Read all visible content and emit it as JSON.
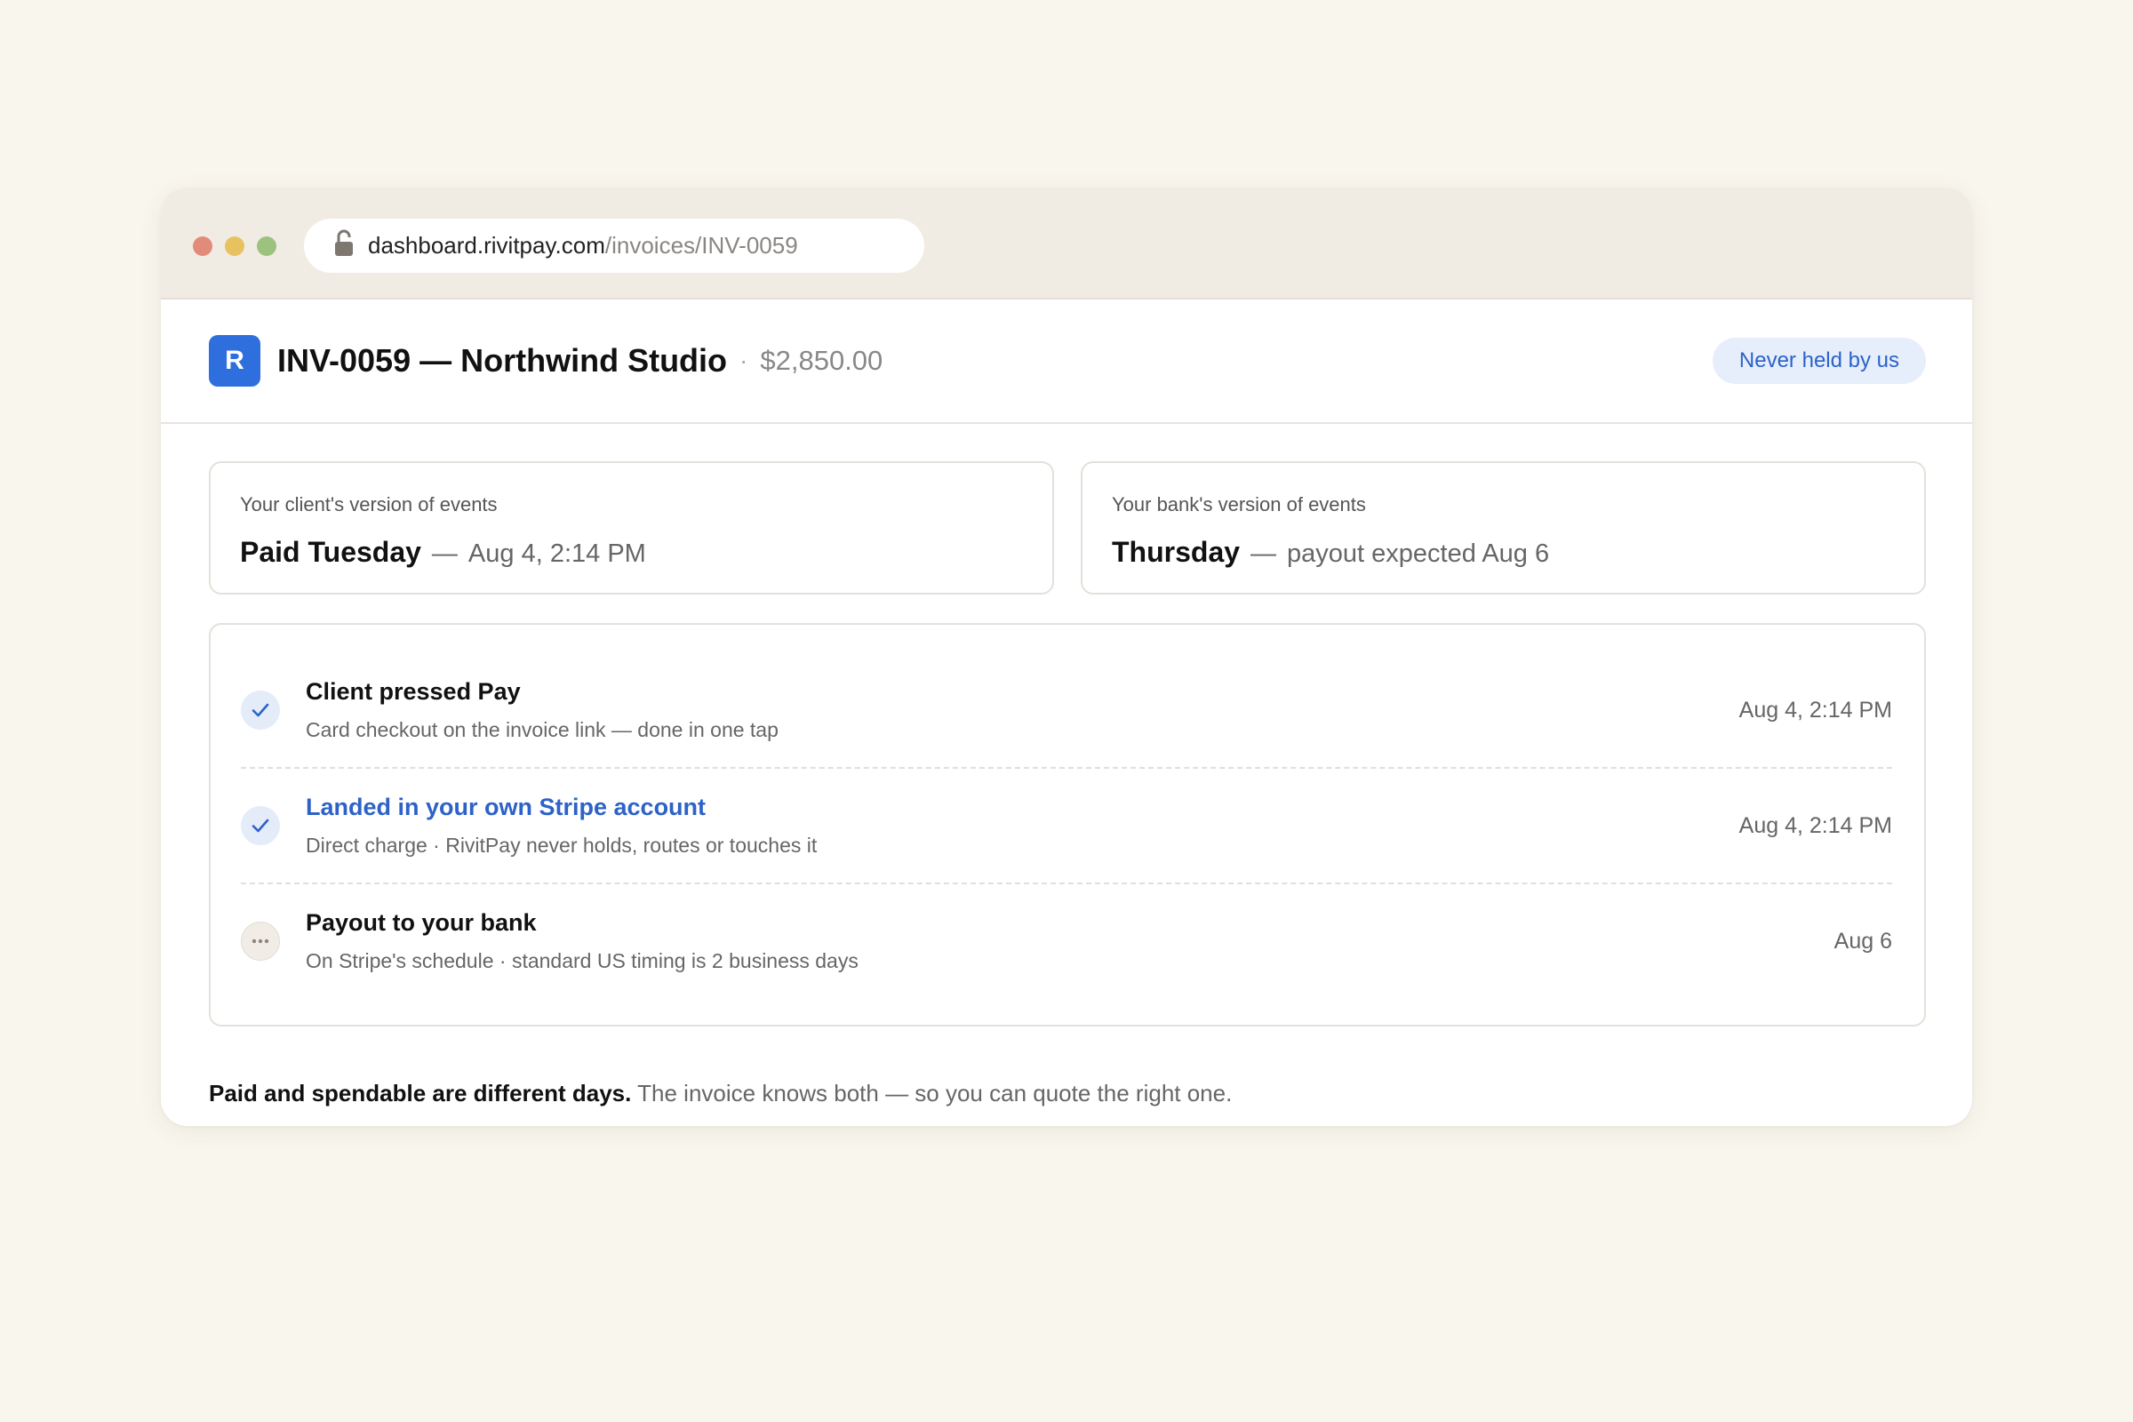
{
  "browser": {
    "url_host": "dashboard.rivitpay.com",
    "url_path": "/invoices/INV-0059"
  },
  "header": {
    "logo_letter": "R",
    "title": "INV-0059 — Northwind Studio",
    "separator": "·",
    "amount": "$2,850.00",
    "badge": "Never held by us"
  },
  "versions": [
    {
      "label": "Your client's version of events",
      "headline": "Paid Tuesday",
      "dash": "—",
      "detail": "Aug 4, 2:14 PM"
    },
    {
      "label": "Your bank's version of events",
      "headline": "Thursday",
      "dash": "—",
      "detail": "payout expected Aug 6"
    }
  ],
  "timeline": [
    {
      "title": "Client pressed Pay",
      "subtitle": "Card checkout on the invoice link — done in one tap",
      "time": "Aug 4, 2:14 PM",
      "status": "done"
    },
    {
      "title": "Landed in your own Stripe account",
      "subtitle": "Direct charge · RivitPay never holds, routes or touches it",
      "time": "Aug 4, 2:14 PM",
      "status": "done"
    },
    {
      "title": "Payout to your bank",
      "subtitle": "On Stripe's schedule · standard US timing is 2 business days",
      "time": "Aug 6",
      "status": "pending"
    }
  ],
  "footnote": {
    "bold": "Paid and spendable are different days.",
    "rest": "The invoice knows both — so you can quote the right one."
  },
  "colors": {
    "accent": "#2f6fdd",
    "link": "#2d62c8",
    "badge_bg": "#e6eefb",
    "page_bg": "#f9f6ee"
  },
  "icons": {
    "done": "check-icon",
    "pending": "ellipsis-icon",
    "url": "lock-icon"
  }
}
